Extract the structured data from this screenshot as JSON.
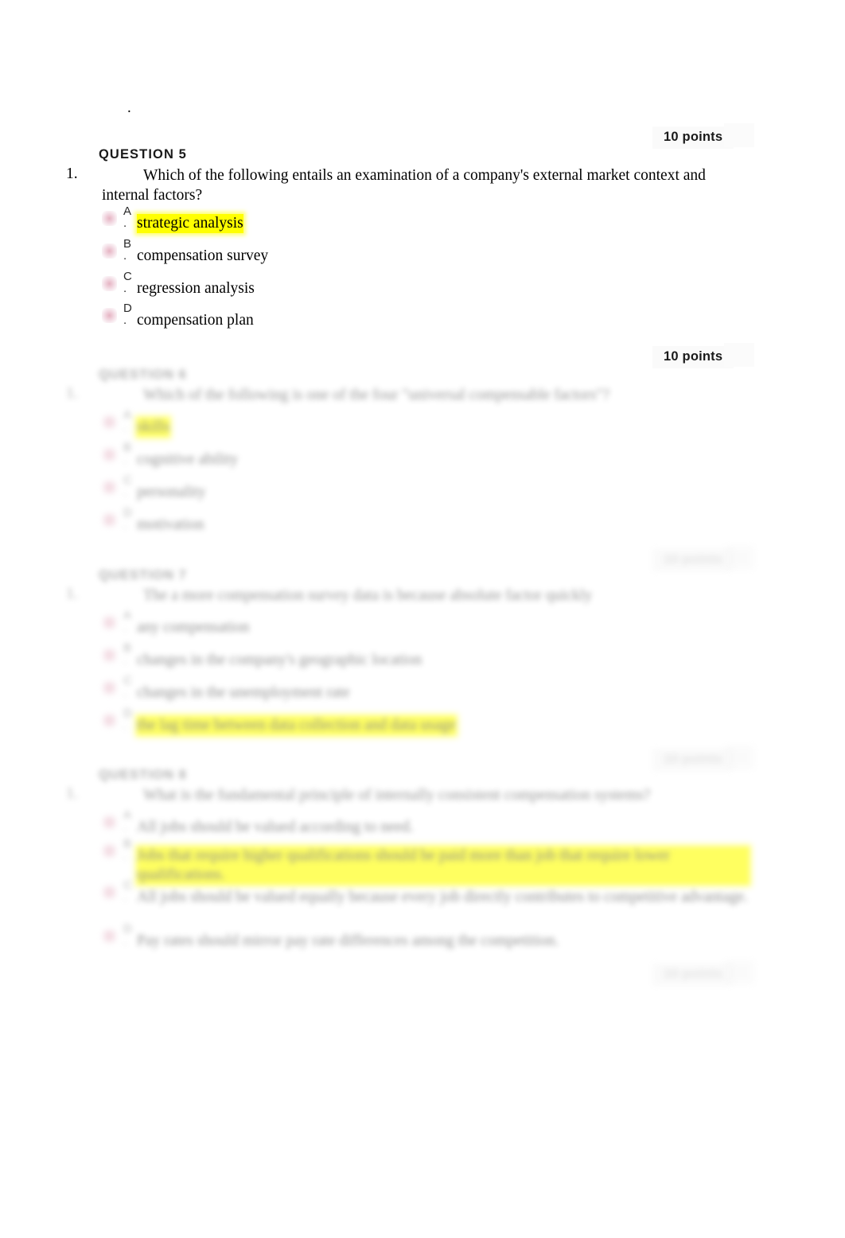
{
  "document": {
    "stray_mark": ".",
    "background_color": "#ffffff",
    "highlight_color": "#ffff00",
    "radio_color": "#e5b0c0"
  },
  "questions": [
    {
      "id": "q5",
      "points_label": "10 points",
      "header": "QUESTION 5",
      "number": "1.",
      "prompt": "Which of the following entails an examination of a company's external market context and internal factors?",
      "blurred": false,
      "options": [
        {
          "letter": "A",
          "dot": ".",
          "text": "strategic analysis",
          "highlighted": true
        },
        {
          "letter": "B",
          "dot": ".",
          "text": "compensation survey",
          "highlighted": false
        },
        {
          "letter": "C",
          "dot": ".",
          "text": "regression analysis",
          "highlighted": false
        },
        {
          "letter": "D",
          "dot": ".",
          "text": "compensation plan",
          "highlighted": false
        }
      ]
    },
    {
      "id": "q6",
      "points_label": "10 points",
      "footer_points_label": "10 points",
      "header": "QUESTION 6",
      "number": "1.",
      "prompt": "Which of the following is one of the four \"universal compensable factors\"?",
      "blurred": true,
      "options": [
        {
          "letter": "A",
          "dot": ".",
          "text": "skills",
          "highlighted": true
        },
        {
          "letter": "B",
          "dot": ".",
          "text": "cognitive ability",
          "highlighted": false
        },
        {
          "letter": "C",
          "dot": ".",
          "text": "personality",
          "highlighted": false
        },
        {
          "letter": "D",
          "dot": ".",
          "text": "motivation",
          "highlighted": false
        }
      ]
    },
    {
      "id": "q7",
      "points_label": "10 points",
      "header": "QUESTION 7",
      "number": "1.",
      "prompt": "The a more compensation survey data is because absolute factor quickly",
      "blurred": true,
      "options": [
        {
          "letter": "A",
          "dot": ".",
          "text": "any compensation",
          "highlighted": false
        },
        {
          "letter": "B",
          "dot": ".",
          "text": "changes in the company's geographic location",
          "highlighted": false
        },
        {
          "letter": "C",
          "dot": ".",
          "text": "changes in the unemployment rate",
          "highlighted": false
        },
        {
          "letter": "D",
          "dot": ".",
          "text": "the lag time between data collection and data usage",
          "highlighted": true
        }
      ]
    },
    {
      "id": "q8",
      "points_label": "10 points",
      "header": "QUESTION 8",
      "number": "1.",
      "prompt": "What is the fundamental principle of internally consistent compensation systems?",
      "blurred": true,
      "options": [
        {
          "letter": "A",
          "dot": ".",
          "text": "All jobs should be valued according to need.",
          "highlighted": false
        },
        {
          "letter": "B",
          "dot": ".",
          "text": "Jobs that require higher qualifications should be paid more than job that require lower qualifications.",
          "highlighted": true
        },
        {
          "letter": "C",
          "dot": ".",
          "text": "All jobs should be valued equally because every job directly contributes to competitive advantage.",
          "highlighted": false
        },
        {
          "letter": "D",
          "dot": ".",
          "text": "Pay rates should mirror pay rate differences among the competition.",
          "highlighted": false
        }
      ]
    }
  ]
}
